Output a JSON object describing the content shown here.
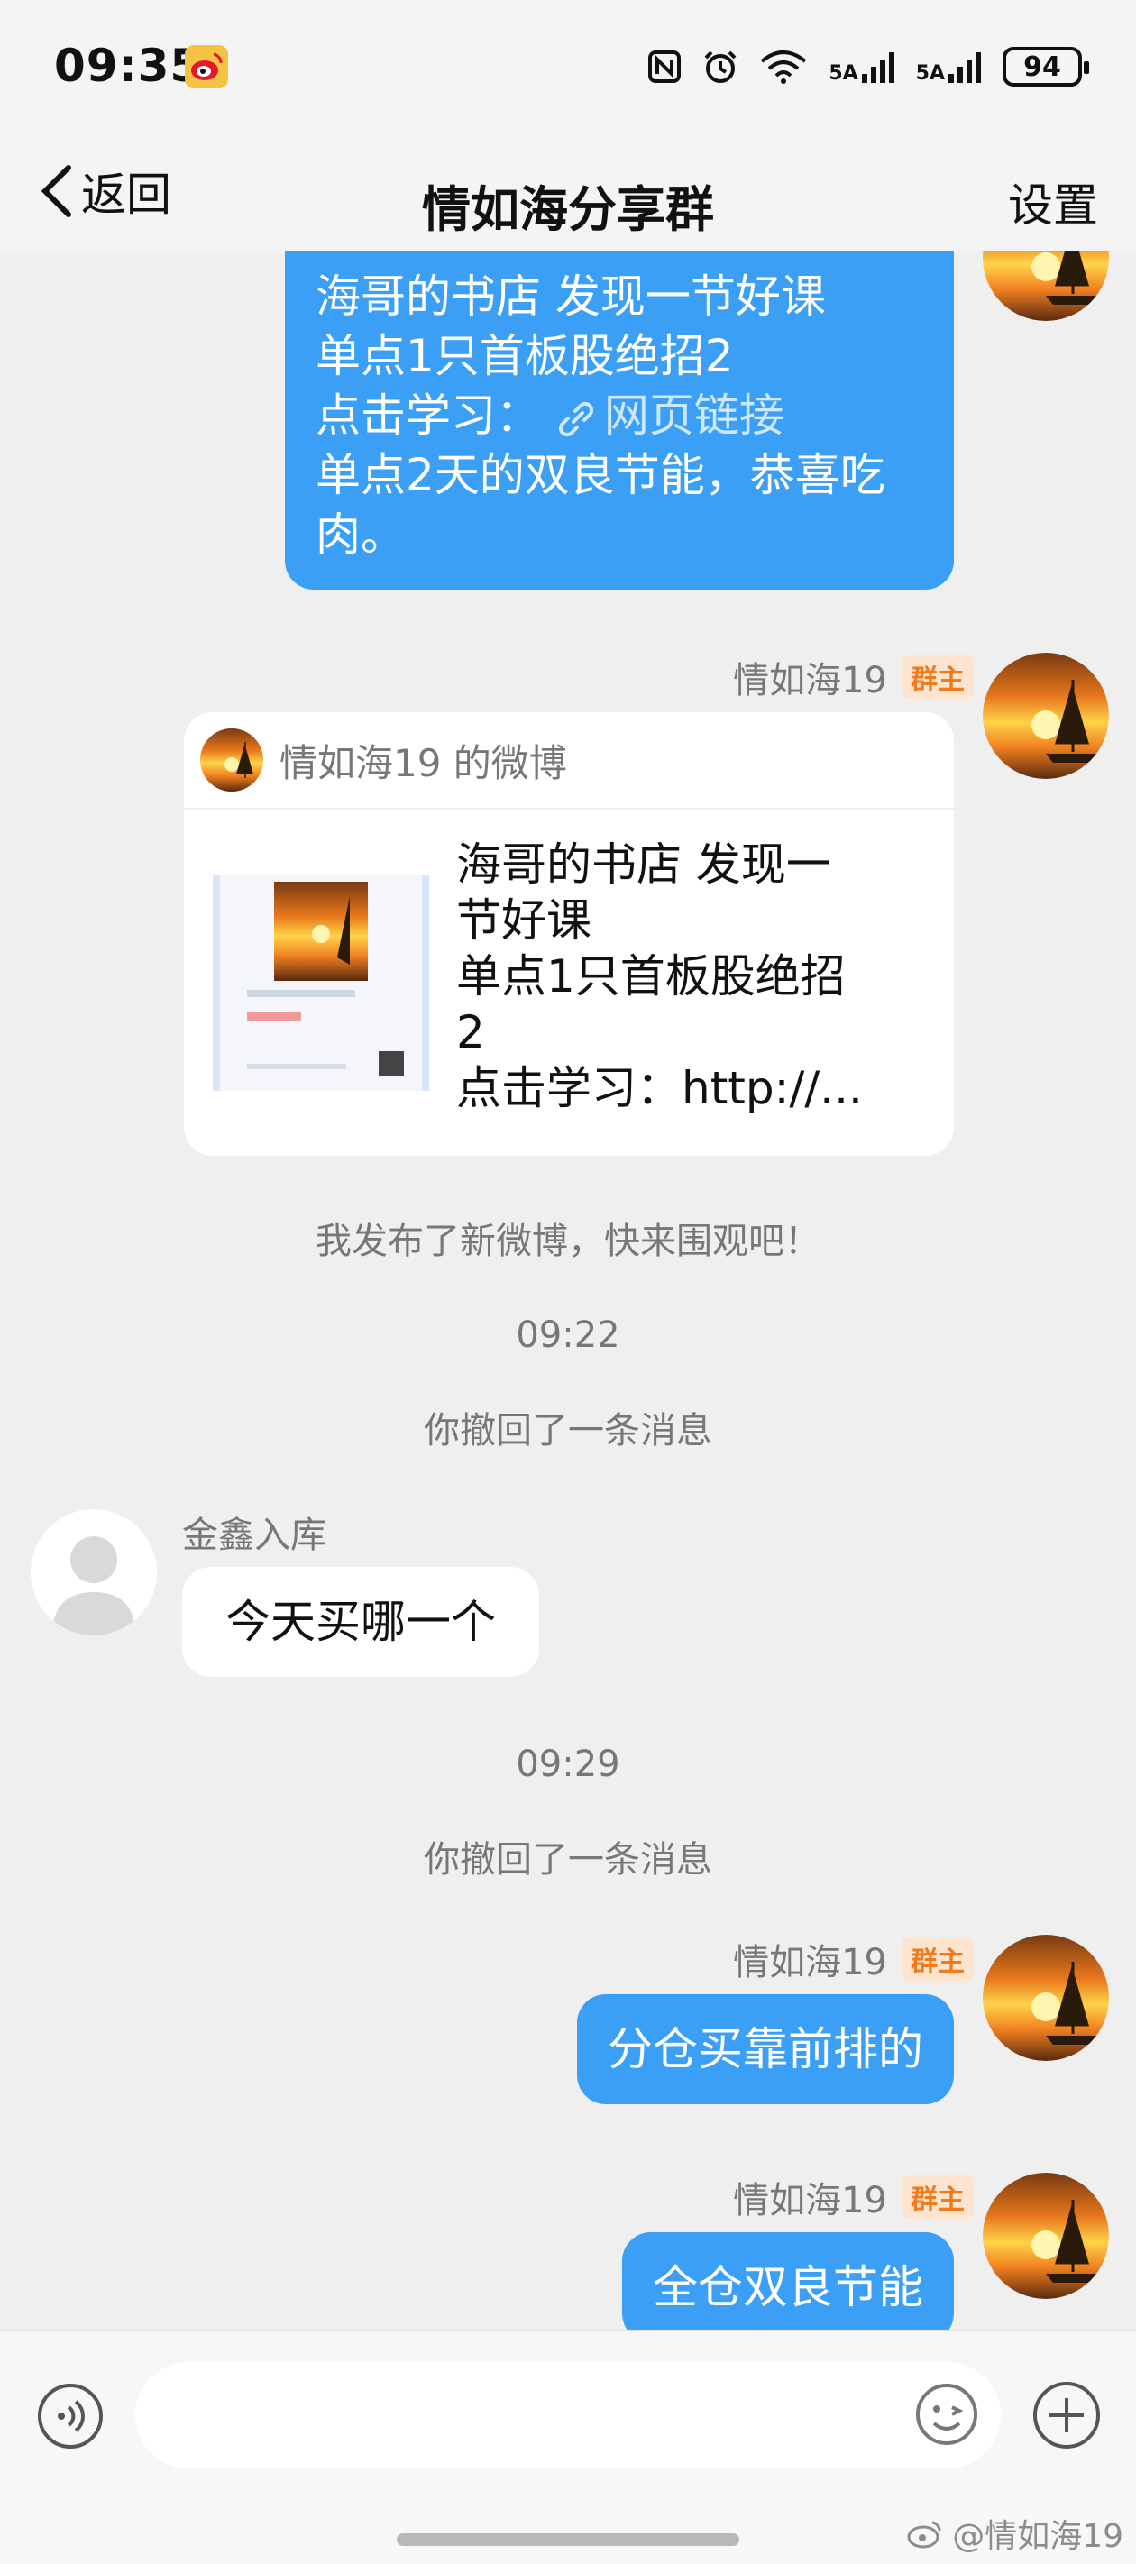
{
  "status_bar": {
    "time": "09:35",
    "battery": "94",
    "signal1": "5A",
    "signal2": "5A"
  },
  "nav": {
    "back_label": "返回",
    "title": "情如海分享群",
    "settings_label": "设置"
  },
  "messages": {
    "m1": {
      "line1": "海哥的书店 发现一节好课",
      "line2": "单点1只首板股绝招2",
      "line3_prefix": "点击学习：",
      "link_text": "网页链接",
      "line4": "单点2天的双良节能，恭喜吃",
      "line5": "肉。"
    },
    "m2": {
      "sender": "情如海19",
      "badge": "群主",
      "card_header": "情如海19 的微博",
      "card_lines": [
        "海哥的书店 发现一",
        "节好课",
        "单点1只首板股绝招",
        "2",
        "点击学习：http://..."
      ]
    },
    "sys1": "我发布了新微博，快来围观吧！",
    "time1": "09:22",
    "sys2": "你撤回了一条消息",
    "m3": {
      "sender": "金鑫入库",
      "text": "今天买哪一个"
    },
    "time2": "09:29",
    "sys3": "你撤回了一条消息",
    "m4": {
      "sender": "情如海19",
      "badge": "群主",
      "text": "分仓买靠前排的"
    },
    "m5": {
      "sender": "情如海19",
      "badge": "群主",
      "text": "全仓双良节能"
    }
  },
  "watermark": "@情如海19",
  "colors": {
    "bubble_me": "#3ba0f5",
    "badge_text": "#f07a1c",
    "badge_bg": "#fde4cf"
  },
  "icons": [
    "weibo-icon",
    "nfc-icon",
    "alarm-icon",
    "wifi-icon",
    "signal-icon",
    "chevron-left-icon",
    "link-icon",
    "voice-icon",
    "emoji-icon",
    "plus-icon"
  ]
}
